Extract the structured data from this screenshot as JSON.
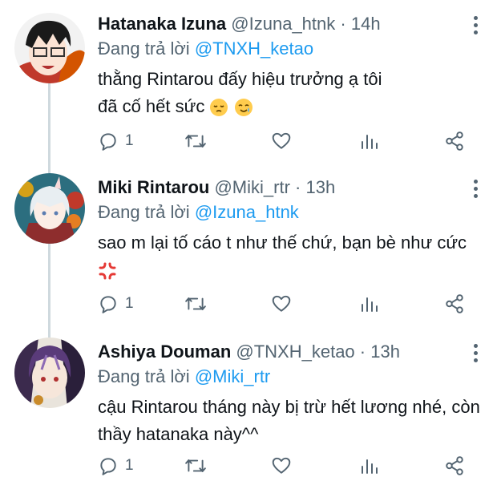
{
  "colors": {
    "link": "#1d9bf0",
    "meta": "#536471",
    "text": "#0f1419",
    "thread_line": "#cfd9de"
  },
  "tweets": [
    {
      "name": "Hatanaka Izuna",
      "handle": "@Izuna_htnk",
      "time": "· 14h",
      "reply_prefix": "Đang trả lời",
      "reply_to": "@TNXH_ketao",
      "text": "thằng Rintarou đấy hiệu trưởng ạ tôi đã cố hết sức",
      "emojis": [
        "pensive-face",
        "smiling-face-with-tear"
      ],
      "reply_count": "1",
      "avatar_icon": "avatar-glasses-red-scarf"
    },
    {
      "name": "Miki Rintarou",
      "handle": "@Miki_rtr",
      "time": "· 13h",
      "reply_prefix": "Đang trả lời",
      "reply_to": "@Izuna_htnk",
      "text": "sao m lại tố cáo t như thế chứ, bạn bè như cức",
      "emojis": [
        "anger-symbol"
      ],
      "reply_count": "1",
      "avatar_icon": "avatar-white-hair-oni"
    },
    {
      "name": "Ashiya Douman",
      "handle": "@TNXH_ketao",
      "time": "· 13h",
      "reply_prefix": "Đang trả lời",
      "reply_to": "@Miki_rtr",
      "text": "cậu Rintarou tháng này bị trừ hết lương nhé, còn thầy hatanaka này^^",
      "emojis": [],
      "reply_count": "1",
      "avatar_icon": "avatar-purple-hair"
    }
  ]
}
